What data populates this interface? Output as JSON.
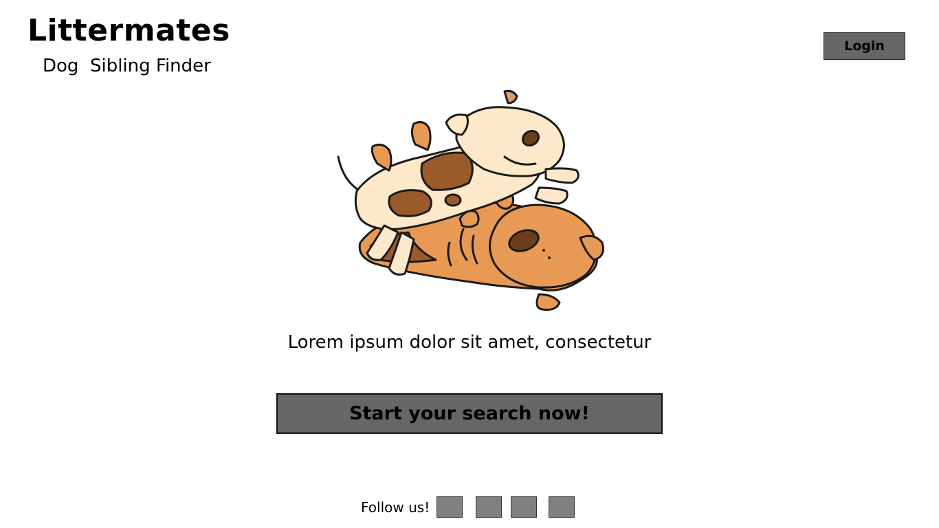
{
  "header": {
    "title": "Littermates",
    "subtitle": "Dog  Sibling Finder",
    "login_label": "Login"
  },
  "hero": {
    "image": "puppies-illustration"
  },
  "main": {
    "tagline": "Lorem ipsum dolor sit amet, consectetur",
    "cta_label": "Start your search now!"
  },
  "footer": {
    "follow_label": "Follow us!",
    "social_icons": [
      "social-icon-1",
      "social-icon-2",
      "social-icon-3",
      "social-icon-4"
    ]
  },
  "colors": {
    "button_bg": "#666666",
    "social_bg": "#808080",
    "dog_cream": "#fde9c9",
    "dog_orange": "#e89a55",
    "spot_brown": "#9b5a2b"
  }
}
